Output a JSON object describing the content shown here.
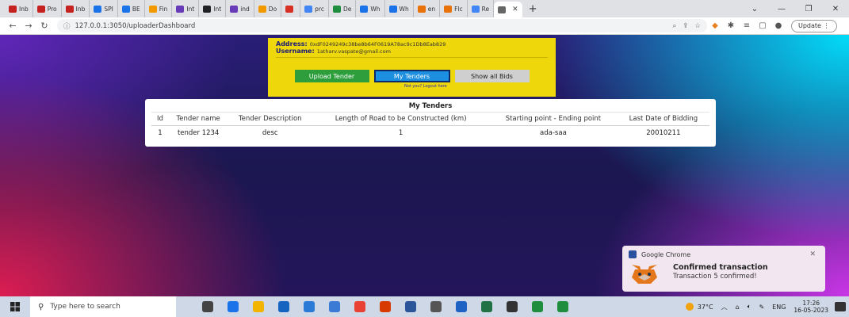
{
  "browser": {
    "tabs": [
      {
        "label": "Inb",
        "color": "#c5221f"
      },
      {
        "label": "Pro",
        "color": "#c5221f"
      },
      {
        "label": "Inb",
        "color": "#c5221f"
      },
      {
        "label": "SPI",
        "color": "#1a73e8"
      },
      {
        "label": "BE",
        "color": "#1a73e8"
      },
      {
        "label": "Fin",
        "color": "#f29900"
      },
      {
        "label": "Int",
        "color": "#673ab7"
      },
      {
        "label": "Int",
        "color": "#202124"
      },
      {
        "label": "ind",
        "color": "#673ab7"
      },
      {
        "label": "Do",
        "color": "#f29900"
      },
      {
        "label": "",
        "color": "#d93025"
      },
      {
        "label": "prc",
        "color": "#4285f4"
      },
      {
        "label": "De",
        "color": "#1e8e3e"
      },
      {
        "label": "Wh",
        "color": "#1a73e8"
      },
      {
        "label": "Wh",
        "color": "#1a73e8"
      },
      {
        "label": "en",
        "color": "#e8710a"
      },
      {
        "label": "Flc",
        "color": "#e8710a"
      },
      {
        "label": "Re",
        "color": "#4285f4"
      }
    ],
    "url": "127.0.0.1:3050/uploaderDashboard",
    "update_label": "Update"
  },
  "user": {
    "address_label": "Address:",
    "address": "0xdF0249249c38be8b64F0619A78ac9c1Db8Eab829",
    "username_label": "Username:",
    "username": "1atharv.vaspate@gmail.com"
  },
  "buttons": {
    "upload": "Upload Tender",
    "my_tenders": "My Tenders",
    "show_bids": "Show all Bids",
    "logout_note": "Not you? Logout here"
  },
  "tenders": {
    "caption": "My Tenders",
    "headers": [
      "Id",
      "Tender name",
      "Tender Description",
      "Length of Road to be Constructed (km)",
      "Starting point - Ending point",
      "Last Date of Bidding"
    ],
    "rows": [
      [
        "1",
        "tender 1234",
        "desc",
        "1",
        "ada-saa",
        "20010211"
      ]
    ]
  },
  "toast": {
    "app": "Google Chrome",
    "title": "Confirmed transaction",
    "message": "Transaction 5 confirmed!"
  },
  "taskbar": {
    "search_placeholder": "Type here to search",
    "temperature": "37°C",
    "lang": "ENG",
    "time": "17:26",
    "date": "16-05-2023",
    "icon_colors": [
      "#444444",
      "#1a73e8",
      "#f2b400",
      "#1565c0",
      "#2a7ad6",
      "#3b7bd6",
      "#e94235",
      "#d83b01",
      "#2b579a",
      "#555555",
      "#1e63c4",
      "#207245",
      "#333333",
      "#1e8e3e",
      "#1e8e3e"
    ]
  }
}
